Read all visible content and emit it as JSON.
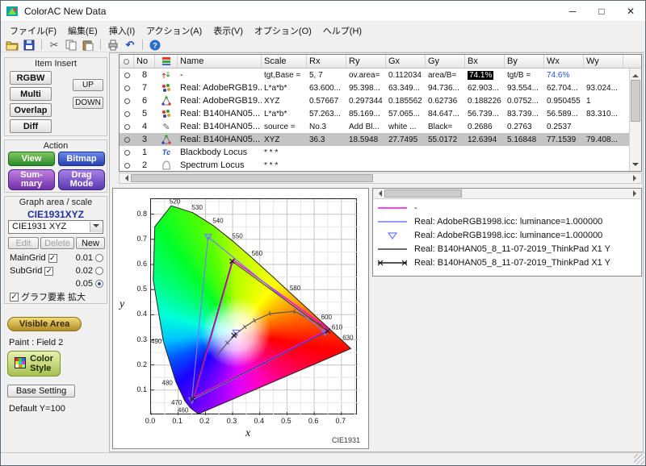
{
  "window": {
    "title": "ColorAC  New Data",
    "minimize": "─",
    "maximize": "□",
    "close": "✕"
  },
  "menu": {
    "items": [
      "ファイル(F)",
      "編集(E)",
      "挿入(I)",
      "アクション(A)",
      "表示(V)",
      "オプション(O)",
      "ヘルプ(H)"
    ]
  },
  "toolbar": {
    "icons": [
      "open-folder",
      "save",
      "cut",
      "copy",
      "paste",
      "print",
      "undo",
      "help"
    ]
  },
  "sidebar": {
    "item_insert": {
      "title": "Item Insert",
      "rgbw": "RGBW",
      "multi": "Multi",
      "overlap": "Overlap",
      "diff": "Diff",
      "up": "UP",
      "down": "DOWN"
    },
    "action": {
      "title": "Action",
      "view": "View",
      "bitmap": "Bitmap",
      "summary_line1": "Sum-",
      "summary_line2": "mary",
      "drag_line1": "Drag",
      "drag_line2": "Mode"
    },
    "graph": {
      "title": "Graph area / scale",
      "scale_name": "CIE1931XYZ",
      "dropdown_value": "CIE1931 XYZ",
      "edit": "Edit",
      "delete": "Delete",
      "new": "New",
      "edit_enabled": false,
      "delete_enabled": false,
      "new_enabled": true,
      "maingrid": "MainGrid",
      "subgrid": "SubGrid",
      "maingrid_checked": true,
      "subgrid_checked": true,
      "grid_options": [
        "0.01",
        "0.02",
        "0.05"
      ],
      "grid_selected": "0.05",
      "zoom_label": "グラフ要素 拡大",
      "zoom_checked": true
    },
    "visible_area": "Visible Area",
    "paint_label": "Paint : Field 2",
    "color_style_line1": "Color",
    "color_style_line2": "Style",
    "base_setting": "Base Setting",
    "default_label": "Default Y=100"
  },
  "table": {
    "headers": {
      "no": "No",
      "name": "Name",
      "scale": "Scale",
      "rx": "Rx",
      "ry": "Ry",
      "gx": "Gx",
      "gy": "Gy",
      "bx": "Bx",
      "by": "By",
      "wx": "Wx",
      "wy": "Wy"
    },
    "rows": [
      {
        "no": "8",
        "icon": "diff-icon",
        "name": "-",
        "values": [
          "tgt,Base =",
          "5, 7",
          "ov.area=",
          "0.112034",
          "area/B=",
          "74.1%",
          "tgt/B =",
          "74.6%",
          ""
        ],
        "value_styles": {
          "5": "inverted",
          "7": "link"
        },
        "selected": false
      },
      {
        "no": "7",
        "icon": "multi-icon",
        "name": "Real: AdobeRGB19...",
        "values": [
          "L*a*b*",
          "63.600...",
          "95.398...",
          "63.349...",
          "94.736...",
          "62.903...",
          "93.554...",
          "62.704...",
          "93.024..."
        ],
        "selected": false
      },
      {
        "no": "6",
        "icon": "overlap-icon",
        "name": "Real: AdobeRGB19...",
        "values": [
          "XYZ",
          "0.57667",
          "0.297344",
          "0.185562",
          "0.62736",
          "0.188226",
          "0.0752...",
          "0.950455",
          "1"
        ],
        "selected": false
      },
      {
        "no": "5",
        "icon": "multi-icon",
        "name": "Real: B140HAN05...",
        "values": [
          "L*a*b*",
          "57.263...",
          "85.169...",
          "57.065...",
          "84.647...",
          "56.739...",
          "83.739...",
          "56.589...",
          "83.310..."
        ],
        "selected": false
      },
      {
        "no": "4",
        "icon": "edit-icon",
        "name": "Real: B140HAN05...",
        "values": [
          "source =",
          "No.3",
          "Add Bl...",
          "white ...",
          "Black=",
          "0.2686",
          "0.2763",
          "0.2537",
          ""
        ],
        "selected": false
      },
      {
        "no": "3",
        "icon": "overlap-icon",
        "name": "Real: B140HAN05...",
        "values": [
          "XYZ",
          "36.3",
          "18.5948",
          "27.7495",
          "55.0172",
          "12.6394",
          "5.16848",
          "77.1539",
          "79.408..."
        ],
        "selected": true
      },
      {
        "no": "1",
        "icon": "tc-icon",
        "name": "Blackbody Locus",
        "values": [
          "* * *",
          "",
          "",
          "",
          "",
          "",
          "",
          "",
          ""
        ],
        "selected": false
      },
      {
        "no": "2",
        "icon": "locus-icon",
        "name": "Spectrum Locus",
        "values": [
          "* * *",
          "",
          "",
          "",
          "",
          "",
          "",
          "",
          ""
        ],
        "selected": false
      }
    ]
  },
  "legend": {
    "items": [
      {
        "sample": "line",
        "color": "#ff00ff",
        "label": "-"
      },
      {
        "sample": "line",
        "color": "#7878ff",
        "label": "Real: AdobeRGB1998.icc: luminance=1.000000"
      },
      {
        "sample": "marker-triangle",
        "color": "#7878ff",
        "label": "Real: AdobeRGB1998.icc: luminance=1.000000"
      },
      {
        "sample": "line",
        "color": "#3a3a3a",
        "label": "Real: B140HAN05_8_11-07-2019_ThinkPad X1 Y"
      },
      {
        "sample": "line-x",
        "color": "#1a1a1a",
        "label": "Real: B140HAN05_8_11-07-2019_ThinkPad X1 Y"
      }
    ]
  },
  "chart_data": {
    "type": "scatter",
    "title": "CIE1931",
    "xlabel": "x",
    "ylabel": "y",
    "xlim": [
      0,
      0.76
    ],
    "ylim": [
      0,
      0.86
    ],
    "xticks": [
      "0.0",
      "0.1",
      "0.2",
      "0.3",
      "0.4",
      "0.5",
      "0.6",
      "0.7"
    ],
    "yticks": [
      "0.1",
      "0.2",
      "0.3",
      "0.4",
      "0.5",
      "0.6",
      "0.7",
      "0.8"
    ],
    "grid": {
      "main_step": 0.1,
      "sub_step": 0.05
    },
    "spectral_locus": [
      [
        0.1741,
        0.005
      ],
      [
        0.144,
        0.0297
      ],
      [
        0.1241,
        0.0578
      ],
      [
        0.0913,
        0.1327
      ],
      [
        0.0454,
        0.295
      ],
      [
        0.0082,
        0.5384
      ],
      [
        0.0139,
        0.7502
      ],
      [
        0.0743,
        0.8338
      ],
      [
        0.1547,
        0.8059
      ],
      [
        0.2296,
        0.7543
      ],
      [
        0.3016,
        0.6923
      ],
      [
        0.3731,
        0.6245
      ],
      [
        0.4441,
        0.5547
      ],
      [
        0.5125,
        0.4866
      ],
      [
        0.5752,
        0.4242
      ],
      [
        0.627,
        0.3725
      ],
      [
        0.6658,
        0.334
      ],
      [
        0.6915,
        0.3083
      ],
      [
        0.7079,
        0.292
      ],
      [
        0.726,
        0.274
      ],
      [
        0.7347,
        0.2653
      ]
    ],
    "wavelength_labels": [
      {
        "t": "520",
        "x": 0.088,
        "y": 0.842
      },
      {
        "t": "530",
        "x": 0.17,
        "y": 0.818
      },
      {
        "t": "540",
        "x": 0.246,
        "y": 0.766
      },
      {
        "t": "550",
        "x": 0.318,
        "y": 0.704
      },
      {
        "t": "560",
        "x": 0.39,
        "y": 0.636
      },
      {
        "t": "580",
        "x": 0.53,
        "y": 0.497
      },
      {
        "t": "600",
        "x": 0.645,
        "y": 0.382
      },
      {
        "t": "610",
        "x": 0.684,
        "y": 0.342
      },
      {
        "t": "630",
        "x": 0.724,
        "y": 0.3
      },
      {
        "t": "490",
        "x": 0.02,
        "y": 0.285
      },
      {
        "t": "480",
        "x": 0.06,
        "y": 0.12
      },
      {
        "t": "470",
        "x": 0.094,
        "y": 0.042
      },
      {
        "t": "460",
        "x": 0.118,
        "y": 0.012
      }
    ],
    "series": [
      {
        "name": "-",
        "type": "line",
        "color": "#ff00ff",
        "width": 1.5,
        "closed": true,
        "points": [
          [
            0.654,
            0.341
          ],
          [
            0.302,
            0.618
          ],
          [
            0.157,
            0.071
          ]
        ]
      },
      {
        "name": "Real: AdobeRGB1998.icc: luminance=1.000000",
        "type": "line",
        "color": "#7878ff",
        "width": 1.2,
        "closed": true,
        "points": [
          [
            0.64,
            0.33
          ],
          [
            0.21,
            0.71
          ],
          [
            0.15,
            0.06
          ]
        ]
      },
      {
        "name": "Real: AdobeRGB1998.icc: luminance=1.000000",
        "type": "marker-triangle",
        "color": "#7878ff",
        "points": [
          [
            0.64,
            0.33
          ],
          [
            0.21,
            0.71
          ],
          [
            0.15,
            0.06
          ],
          [
            0.3127,
            0.329
          ]
        ]
      },
      {
        "name": "Real: B140HAN05_8_11-07-2019_ThinkPad X1 Y",
        "type": "line",
        "color": "#3a3a3a",
        "width": 1,
        "closed": true,
        "points": [
          [
            0.65,
            0.335
          ],
          [
            0.298,
            0.613
          ],
          [
            0.153,
            0.065
          ]
        ]
      },
      {
        "name": "Real: B140HAN05_8_11-07-2019_ThinkPad X1 Y",
        "type": "marker-x",
        "color": "#1a1a1a",
        "points": [
          [
            0.65,
            0.335
          ],
          [
            0.298,
            0.613
          ],
          [
            0.153,
            0.065
          ],
          [
            0.305,
            0.318
          ]
        ]
      }
    ],
    "blackbody_locus": [
      [
        0.6528,
        0.3444
      ],
      [
        0.5267,
        0.4133
      ],
      [
        0.4369,
        0.4041
      ],
      [
        0.3805,
        0.3768
      ],
      [
        0.3451,
        0.3516
      ],
      [
        0.3135,
        0.3236
      ],
      [
        0.2807,
        0.2884
      ],
      [
        0.24,
        0.234
      ]
    ],
    "white_center": [
      0.3127,
      0.329
    ]
  },
  "statusbar": {
    "text": ""
  }
}
